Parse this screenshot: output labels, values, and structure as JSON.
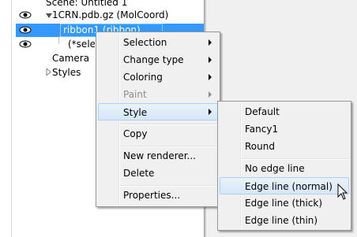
{
  "tree": {
    "scene_label": "Scene: Untitled 1",
    "items": [
      {
        "label": "1CRN.pdb.gz (MolCoord)"
      },
      {
        "label": "ribbon1 (ribbon)"
      },
      {
        "label": "(*selection)"
      },
      {
        "label": "Camera"
      },
      {
        "label": "Styles"
      }
    ]
  },
  "context_menu": {
    "items": [
      {
        "label": "Selection",
        "submenu": true,
        "disabled": false
      },
      {
        "label": "Change type",
        "submenu": true,
        "disabled": false
      },
      {
        "label": "Coloring",
        "submenu": true,
        "disabled": false
      },
      {
        "label": "Paint",
        "submenu": true,
        "disabled": true
      },
      {
        "label": "Style",
        "submenu": true,
        "disabled": false,
        "active": true
      },
      {
        "label": "Copy"
      },
      {
        "label": "New renderer..."
      },
      {
        "label": "Delete"
      },
      {
        "label": "Properties..."
      }
    ]
  },
  "style_submenu": {
    "items": [
      {
        "label": "Default"
      },
      {
        "label": "Fancy1"
      },
      {
        "label": "Round"
      },
      {
        "label": "No edge line"
      },
      {
        "label": "Edge line (normal)",
        "hover": true
      },
      {
        "label": "Edge line (thick)"
      },
      {
        "label": "Edge line (thin)"
      }
    ]
  },
  "colors": {
    "selection": "#3399ff",
    "menu_bg": "#f0f0f0",
    "hover_bg": "#d6e7f9"
  }
}
